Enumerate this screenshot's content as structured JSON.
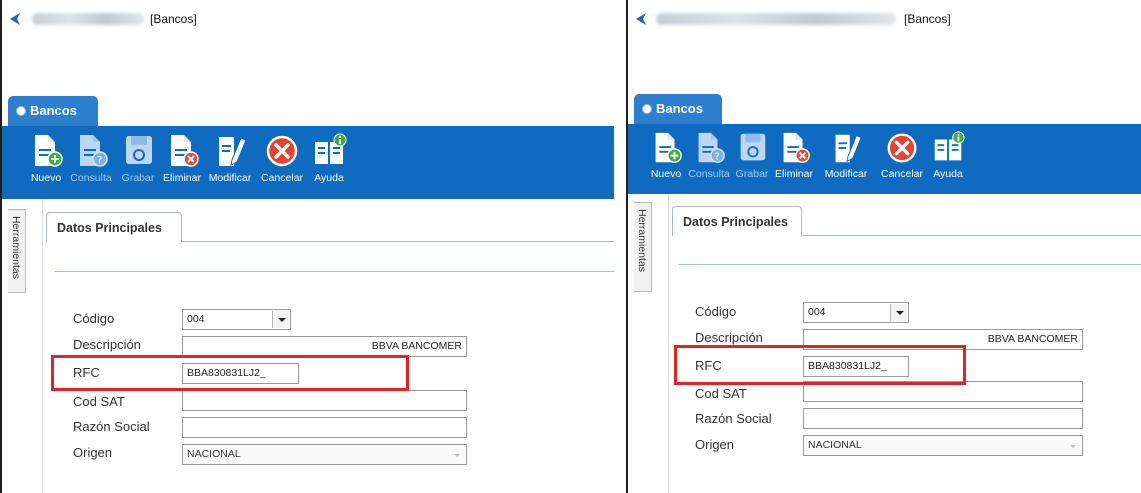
{
  "window": {
    "title": "[Bancos]"
  },
  "module_tab": {
    "label": "Bancos"
  },
  "toolbar": {
    "nuevo": "Nuevo",
    "consulta": "Consulta",
    "grabar": "Grabar",
    "eliminar": "Eliminar",
    "modificar": "Modificar",
    "cancelar": "Cancelar",
    "ayuda": "Ayuda"
  },
  "side_panel": {
    "label": "Herramientas"
  },
  "form_tab": {
    "label": "Datos Principales"
  },
  "form": {
    "codigo_label": "Código",
    "codigo_value": "004",
    "descripcion_label": "Descripción",
    "descripcion_value": "BBVA BANCOMER",
    "rfc_label": "RFC",
    "rfc_value": "BBA830831LJ2_",
    "cod_sat_label": "Cod SAT",
    "cod_sat_value": "",
    "razon_social_label": "Razón Social",
    "razon_social_value": "",
    "origen_label": "Origen",
    "origen_value": "NACIONAL"
  },
  "colors": {
    "ribbon": "#0f6bbf",
    "tab": "#2f7fcf",
    "highlight": "#e32323",
    "add_badge": "#3fae3f",
    "remove_badge": "#e24b3b",
    "cancel": "#e8412f"
  },
  "icons": {
    "nuevo": "new-document-icon",
    "consulta": "query-document-icon",
    "grabar": "save-disk-icon",
    "eliminar": "delete-document-icon",
    "modificar": "edit-pencil-icon",
    "cancelar": "cancel-icon",
    "ayuda": "help-book-icon"
  }
}
